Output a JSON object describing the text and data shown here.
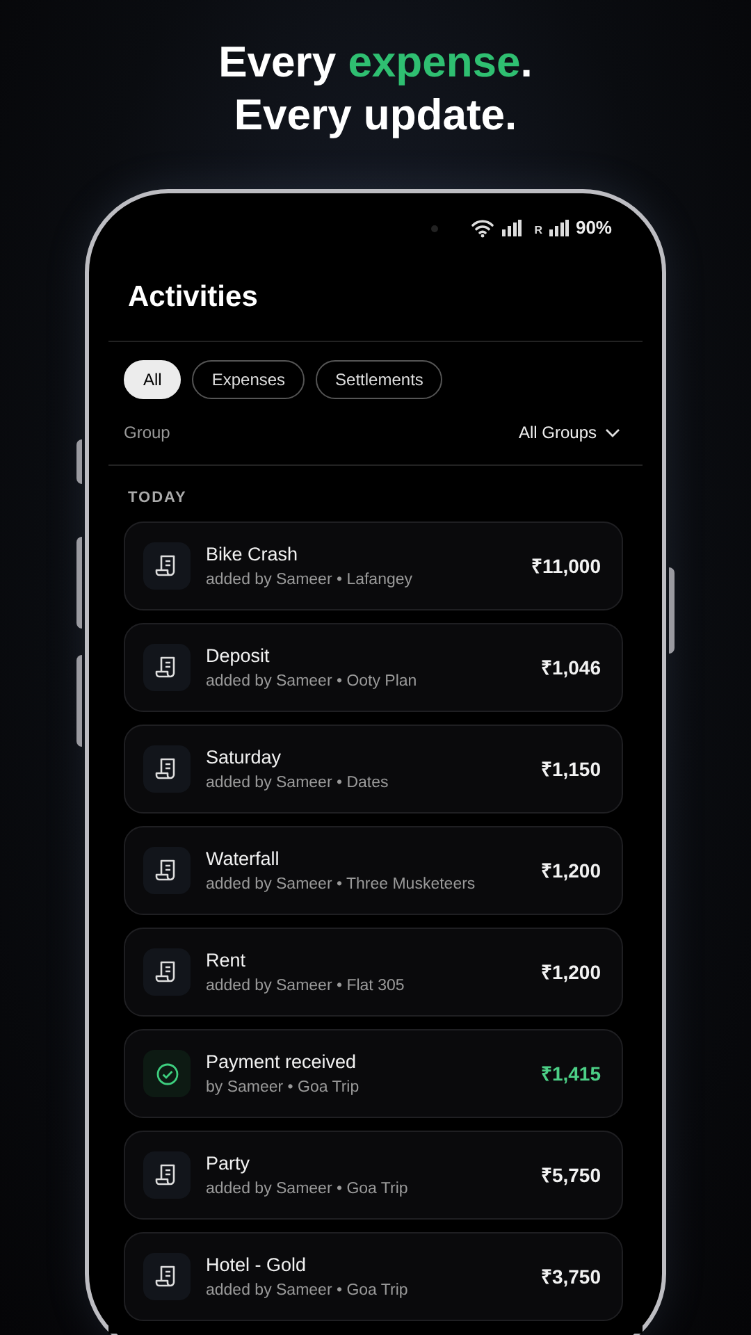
{
  "headline": {
    "lines": [
      [
        {
          "text": "Every ",
          "accent": false
        },
        {
          "text": "expense",
          "accent": true
        },
        {
          "text": ".",
          "accent": false
        }
      ],
      [
        {
          "text": "Every update.",
          "accent": false
        }
      ]
    ]
  },
  "status_bar": {
    "roaming": "R",
    "battery": "90%"
  },
  "title": "Activities",
  "filters": [
    {
      "label": "All",
      "selected": true
    },
    {
      "label": "Expenses",
      "selected": false
    },
    {
      "label": "Settlements",
      "selected": false
    }
  ],
  "group_filter": {
    "label": "Group",
    "value": "All Groups"
  },
  "section": "TODAY",
  "activities": [
    {
      "kind": "expense",
      "title": "Bike Crash",
      "subtitle": "added by Sameer • Lafangey",
      "amount": "₹11,000"
    },
    {
      "kind": "expense",
      "title": "Deposit",
      "subtitle": "added by Sameer • Ooty Plan",
      "amount": "₹1,046"
    },
    {
      "kind": "expense",
      "title": "Saturday",
      "subtitle": "added by Sameer • Dates",
      "amount": "₹1,150"
    },
    {
      "kind": "expense",
      "title": "Waterfall",
      "subtitle": "added by Sameer • Three Musketeers",
      "amount": "₹1,200"
    },
    {
      "kind": "expense",
      "title": "Rent",
      "subtitle": "added by Sameer • Flat 305",
      "amount": "₹1,200"
    },
    {
      "kind": "payment",
      "title": "Payment received",
      "subtitle": "by Sameer • Goa Trip",
      "amount": "₹1,415"
    },
    {
      "kind": "expense",
      "title": "Party",
      "subtitle": "added by Sameer • Goa Trip",
      "amount": "₹5,750"
    },
    {
      "kind": "expense",
      "title": "Hotel - Gold",
      "subtitle": "added by Sameer • Goa Trip",
      "amount": "₹3,750"
    }
  ]
}
